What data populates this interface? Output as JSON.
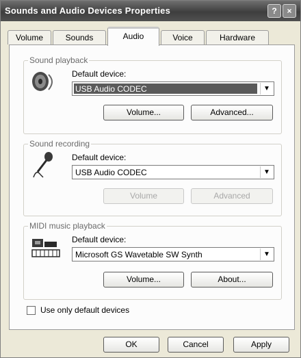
{
  "window": {
    "title": "Sounds and Audio Devices Properties",
    "help_glyph": "?",
    "close_glyph": "×"
  },
  "tabs": [
    {
      "label": "Volume"
    },
    {
      "label": "Sounds"
    },
    {
      "label": "Audio",
      "active": true
    },
    {
      "label": "Voice"
    },
    {
      "label": "Hardware"
    }
  ],
  "sound_playback": {
    "group_label": "Sound playback",
    "default_label": "Default device:",
    "device": "USB Audio CODEC",
    "volume_btn": "Volume...",
    "advanced_btn": "Advanced..."
  },
  "sound_recording": {
    "group_label": "Sound recording",
    "default_label": "Default device:",
    "device": "USB Audio CODEC",
    "volume_btn": "Volume",
    "advanced_btn": "Advanced"
  },
  "midi": {
    "group_label": "MIDI music playback",
    "default_label": "Default device:",
    "device": "Microsoft GS Wavetable SW Synth",
    "volume_btn": "Volume...",
    "about_btn": "About..."
  },
  "use_default_only": {
    "label": "Use only default devices",
    "checked": false
  },
  "footer": {
    "ok": "OK",
    "cancel": "Cancel",
    "apply": "Apply"
  },
  "icons": {
    "playback": "speaker-icon",
    "recording": "microphone-icon",
    "midi": "midi-keyboard-icon",
    "dropdown": "chevron-down-icon"
  }
}
